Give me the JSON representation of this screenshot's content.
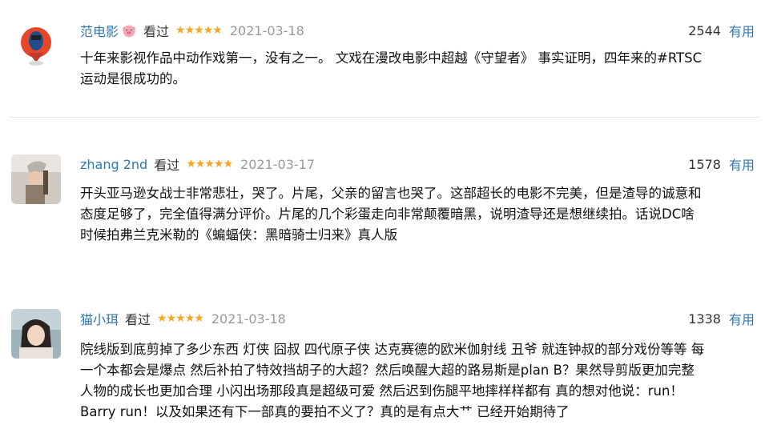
{
  "reviews": [
    {
      "username": "范电影",
      "badge_icon": "pig-face-icon",
      "status": "看过",
      "stars": 5,
      "star_glyphs": [
        "★",
        "★",
        "★",
        "★",
        "★"
      ],
      "date": "2021-03-18",
      "votes": "2544",
      "useful_label": "有用",
      "lines": [
        "十年来影视作品中动作戏第一，没有之一。 文戏在漫改电影中超越《守望者》 事实证明，四年来的#RTSC",
        "运动是很成功的。"
      ]
    },
    {
      "username": "zhang 2nd",
      "status": "看过",
      "stars": 5,
      "star_glyphs": [
        "★",
        "★",
        "★",
        "★",
        "★"
      ],
      "date": "2021-03-17",
      "votes": "1578",
      "useful_label": "有用",
      "lines": [
        "开头亚马逊女战士非常悲壮，哭了。片尾，父亲的留言也哭了。这部超长的电影不完美，但是渣导的诚意和",
        "态度足够了，完全值得满分评价。片尾的几个彩蛋走向非常颠覆暗黑，说明渣导还是想继续拍。话说DC啥",
        "时候拍弗兰克米勒的《蝙蝠侠：黑暗骑士归来》真人版"
      ]
    },
    {
      "username": "猫小珥",
      "status": "看过",
      "stars": 5,
      "star_glyphs": [
        "★",
        "★",
        "★",
        "★",
        "★"
      ],
      "date": "2021-03-18",
      "votes": "1338",
      "useful_label": "有用",
      "lines": [
        "院线版到底剪掉了多少东西 灯侠 囧叔 四代原子侠 达克赛德的欧米伽射线 丑爷 就连钟叔的部分戏份等等 每",
        "一个本都会是爆点 然后补拍了特效挡胡子的大超？然后唤醒大超的路易斯是plan B？果然导剪版更加完整",
        "人物的成长也更加合理 小闪出场那段真是超级可爱 然后迟到伤腿平地摔样样都有 真的想对他说：run！",
        "Barry run！以及如果还有下一部真的要拍不义了？真的是有点大艹 已经开始期待了"
      ]
    }
  ],
  "colors": {
    "link": "#3377aa",
    "star": "#f5a623",
    "date": "#999999"
  }
}
